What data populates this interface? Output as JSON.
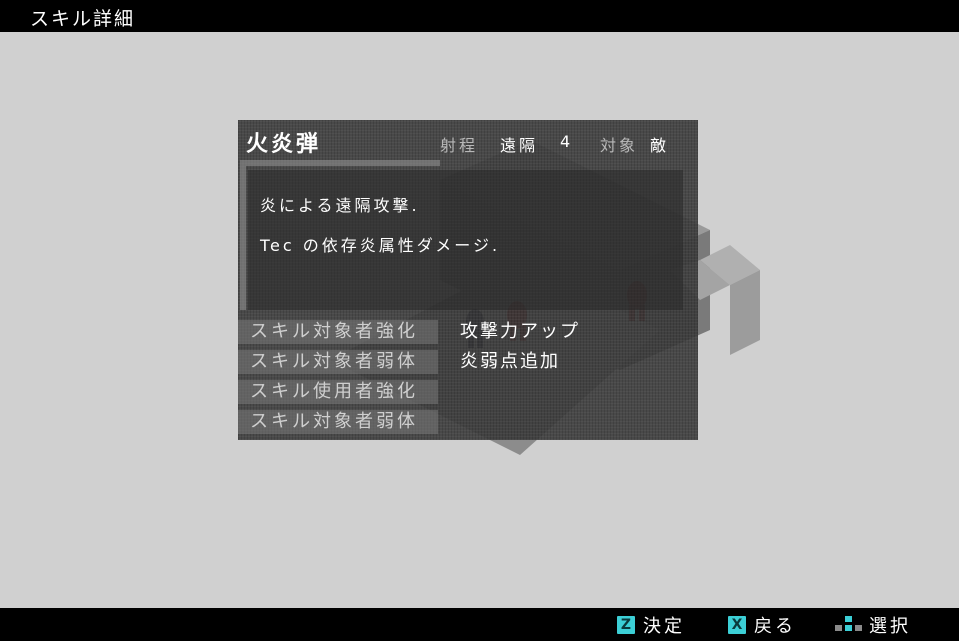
{
  "header": {
    "title": "スキル詳細"
  },
  "skill": {
    "name": "火炎弾",
    "range_label": "射程",
    "range_type": "遠隔",
    "range_value": "4",
    "target_label": "対象",
    "target_value": "敵",
    "description": [
      "炎による遠隔攻撃.",
      "Tec の依存炎属性ダメージ."
    ],
    "effects": [
      {
        "label": "スキル対象者強化",
        "value": "攻撃力アップ"
      },
      {
        "label": "スキル対象者弱体",
        "value": "炎弱点追加"
      },
      {
        "label": "スキル使用者強化",
        "value": ""
      },
      {
        "label": "スキル対象者弱体",
        "value": ""
      }
    ]
  },
  "footer": {
    "confirm": {
      "key": "Z",
      "label": "決定"
    },
    "back": {
      "key": "X",
      "label": "戻る"
    },
    "select": {
      "icon": "dpad-icon",
      "label": "選択"
    }
  },
  "colors": {
    "accent": "#3ccfd6",
    "bar": "#000000",
    "background": "#d0d0d0"
  }
}
